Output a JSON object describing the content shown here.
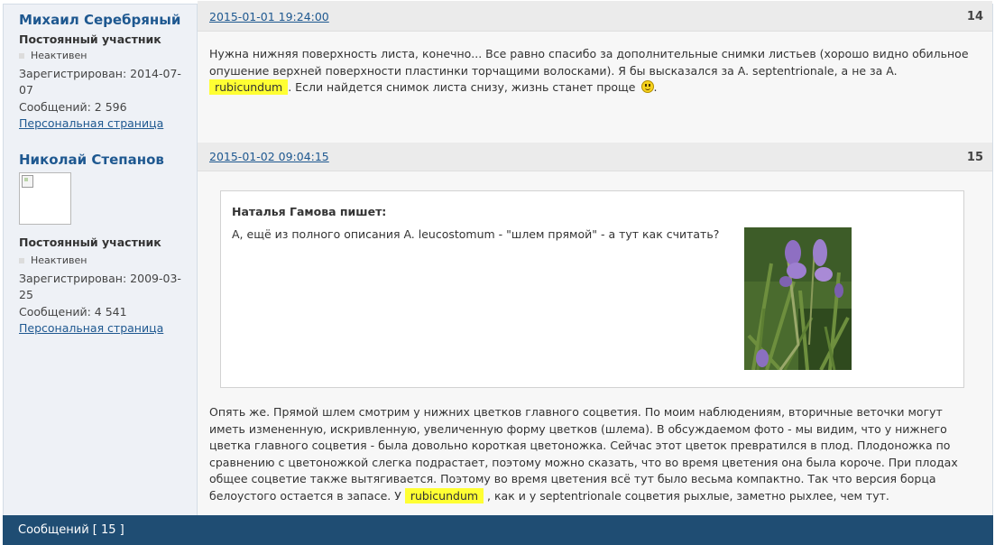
{
  "posts": [
    {
      "author": {
        "name": "Михаил Серебряный",
        "rank": "Постоянный участник",
        "status": "Неактивен",
        "registered": "Зарегистрирован: 2014-07-07",
        "messages": "Сообщений: 2 596",
        "profile_link": "Персональная страница"
      },
      "date": "2015-01-01 19:24:00",
      "number": "14",
      "text_before": "Нужна нижняя поверхность листа, конечно... Все равно спасибо за дополнительные снимки листьев (хорошо видно обильное опушение верхней поверхности пластинки торчащими волосками). Я бы высказался за A. septentrionale, а не за A.",
      "highlight": "rubicundum",
      "text_after": ". Если найдется снимок листа снизу, жизнь станет проще",
      "text_end": "."
    },
    {
      "author": {
        "name": "Николай Степанов",
        "rank": "Постоянный участник",
        "status": "Неактивен",
        "registered": "Зарегистрирован: 2009-03-25",
        "messages": "Сообщений: 4 541",
        "profile_link": "Персональная страница"
      },
      "date": "2015-01-02 09:04:15",
      "number": "15",
      "quote": {
        "author": "Наталья Гамова пишет:",
        "text": "А, ещё из полного описания A. leucostomum - \"шлем прямой\" - а тут как считать?"
      },
      "text_before": "Опять же. Прямой шлем смотрим у нижних цветков главного соцветия. По моим наблюдениям, вторичные веточки могут иметь измененную, искривленную, увеличенную форму цветков (шлема). В обсуждаемом фото - мы видим, что у нижнего цветка главного соцветия - была довольно короткая цветоножка. Сейчас этот цветок превратился в плод. Плодоножка по сравнению с цветоножкой слегка подрастает, поэтому можно сказать, что во время цветения она была короче. При плодах общее соцветие также вытягивается. Поэтому во время цветения всё тут было весьма компактно. Так что версия борца белоустого остается в запасе. У",
      "highlight": "rubicundum",
      "text_after": ", как и у septentrionale соцветия рыхлые, заметно рыхлее, чем тут."
    }
  ],
  "footer": {
    "label": "Сообщений [ 15 ]"
  },
  "colors": {
    "link": "#1e5890",
    "footer_bg": "#1f4d73",
    "highlight": "#ffff33"
  }
}
